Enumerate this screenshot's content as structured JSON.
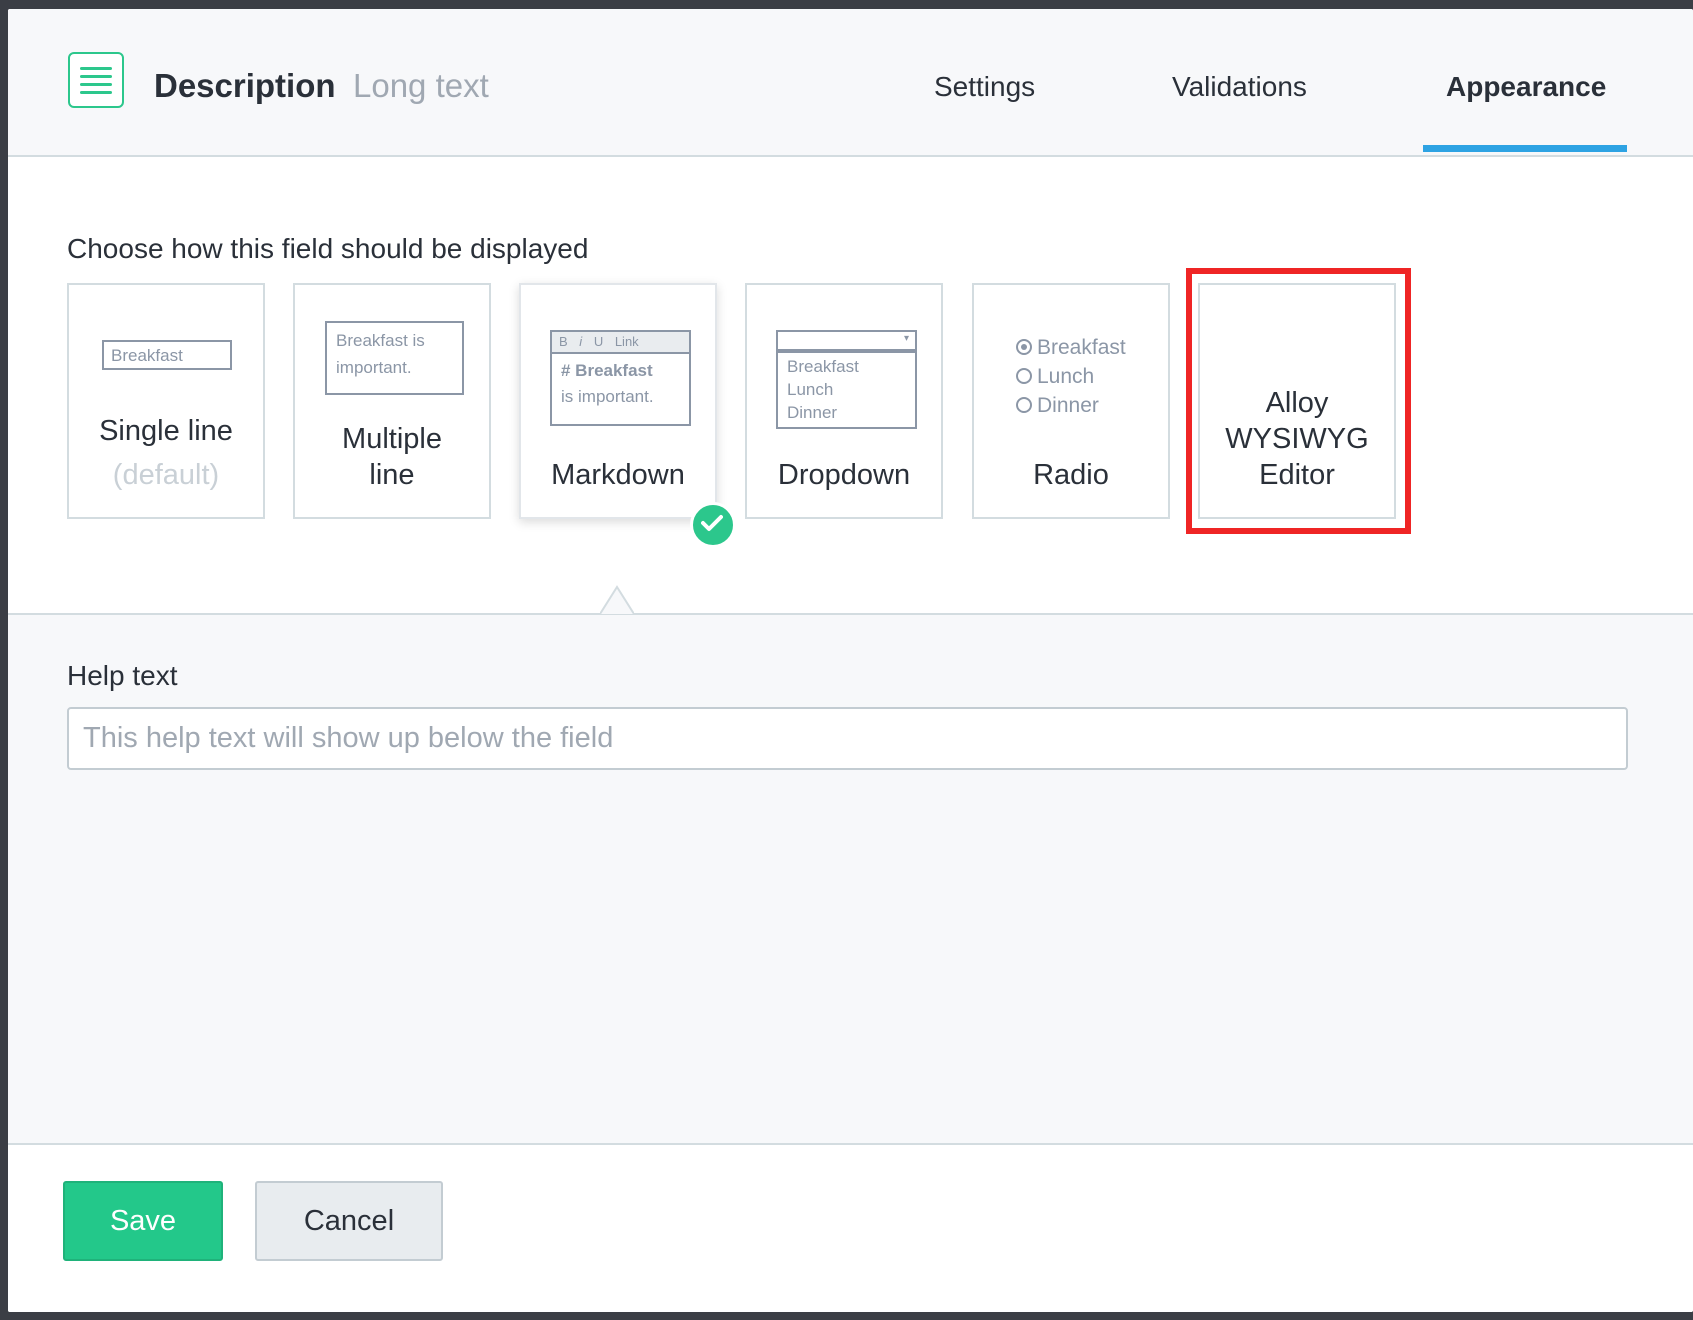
{
  "header": {
    "field_name": "Description",
    "field_type": "Long text",
    "tabs": [
      {
        "label": "Settings",
        "active": false
      },
      {
        "label": "Validations",
        "active": false
      },
      {
        "label": "Appearance",
        "active": true
      }
    ]
  },
  "appearance": {
    "heading": "Choose how this field should be displayed",
    "selected": "Markdown",
    "options": [
      {
        "label": "Single line",
        "sublabel": "(default)",
        "preview": "Breakfast"
      },
      {
        "label_line1": "Multiple",
        "label_line2": "line",
        "preview_line1": "Breakfast is",
        "preview_line2": "important."
      },
      {
        "label": "Markdown",
        "toolbar": [
          "B",
          "i",
          "U",
          "Link"
        ],
        "preview_line1": "# Breakfast",
        "preview_line2": "is important."
      },
      {
        "label": "Dropdown",
        "items": [
          "Breakfast",
          "Lunch",
          "Dinner"
        ]
      },
      {
        "label": "Radio",
        "items": [
          "Breakfast",
          "Lunch",
          "Dinner"
        ]
      },
      {
        "label_line1": "Alloy",
        "label_line2": "WYSIWYG",
        "label_line3": "Editor"
      }
    ]
  },
  "help": {
    "label": "Help text",
    "placeholder": "This help text will show up below the field",
    "value": ""
  },
  "footer": {
    "save_label": "Save",
    "cancel_label": "Cancel"
  },
  "colors": {
    "accent_green": "#23c88a",
    "tab_underline": "#2ea3e3",
    "highlight_red": "#ef2525"
  }
}
